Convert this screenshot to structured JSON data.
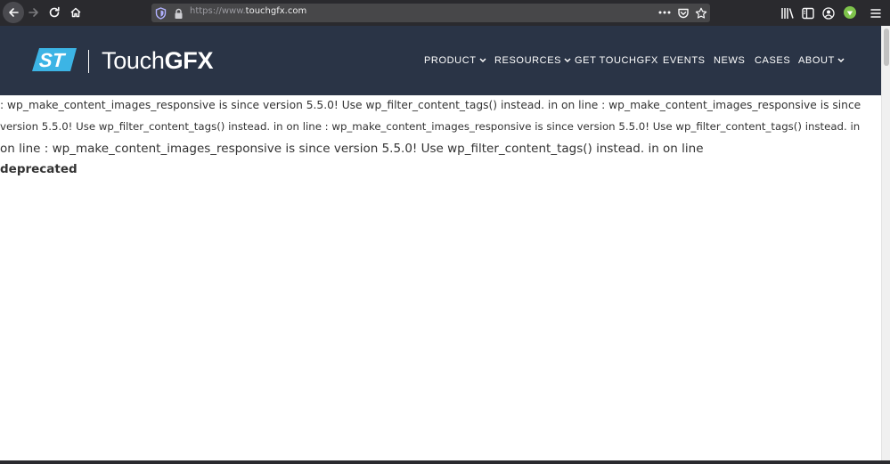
{
  "browser": {
    "url_prefix": "https://www.",
    "url_host": "touchgfx.com",
    "toolbar_icons": [
      "back-arrow-icon",
      "forward-arrow-icon",
      "reload-icon",
      "home-icon",
      "shield-icon",
      "lock-icon",
      "more-dots-icon",
      "pocket-icon",
      "bookmark-star-icon",
      "library-icon",
      "sidebar-icon",
      "account-icon",
      "extension-icon",
      "menu-icon"
    ]
  },
  "site": {
    "brand_touch": "Touch",
    "brand_gfx": "GFX",
    "nav": [
      {
        "label": "PRODUCT",
        "dropdown": true
      },
      {
        "label": "RESOURCES",
        "dropdown": true
      },
      {
        "label": "GET TOUCHGFX",
        "dropdown": false
      },
      {
        "label": "EVENTS",
        "dropdown": false
      },
      {
        "label": "NEWS",
        "dropdown": false
      },
      {
        "label": "CASES",
        "dropdown": false
      },
      {
        "label": "ABOUT",
        "dropdown": true
      }
    ]
  },
  "content": {
    "lines": [
      ": wp_make_content_images_responsive is since version 5.5.0! Use wp_filter_content_tags() instead. in on line : wp_make_content_images_responsive is since",
      "version 5.5.0! Use wp_filter_content_tags() instead. in on line : wp_make_content_images_responsive is since version 5.5.0! Use wp_filter_content_tags() instead. in",
      "on line : wp_make_content_images_responsive is since version 5.5.0! Use wp_filter_content_tags() instead. in on line"
    ],
    "deprecated": "deprecated"
  },
  "colors": {
    "header_bg": "#2a3446",
    "toolbar_bg": "#2a2a2e",
    "accent_blue": "#3cb4e5"
  }
}
